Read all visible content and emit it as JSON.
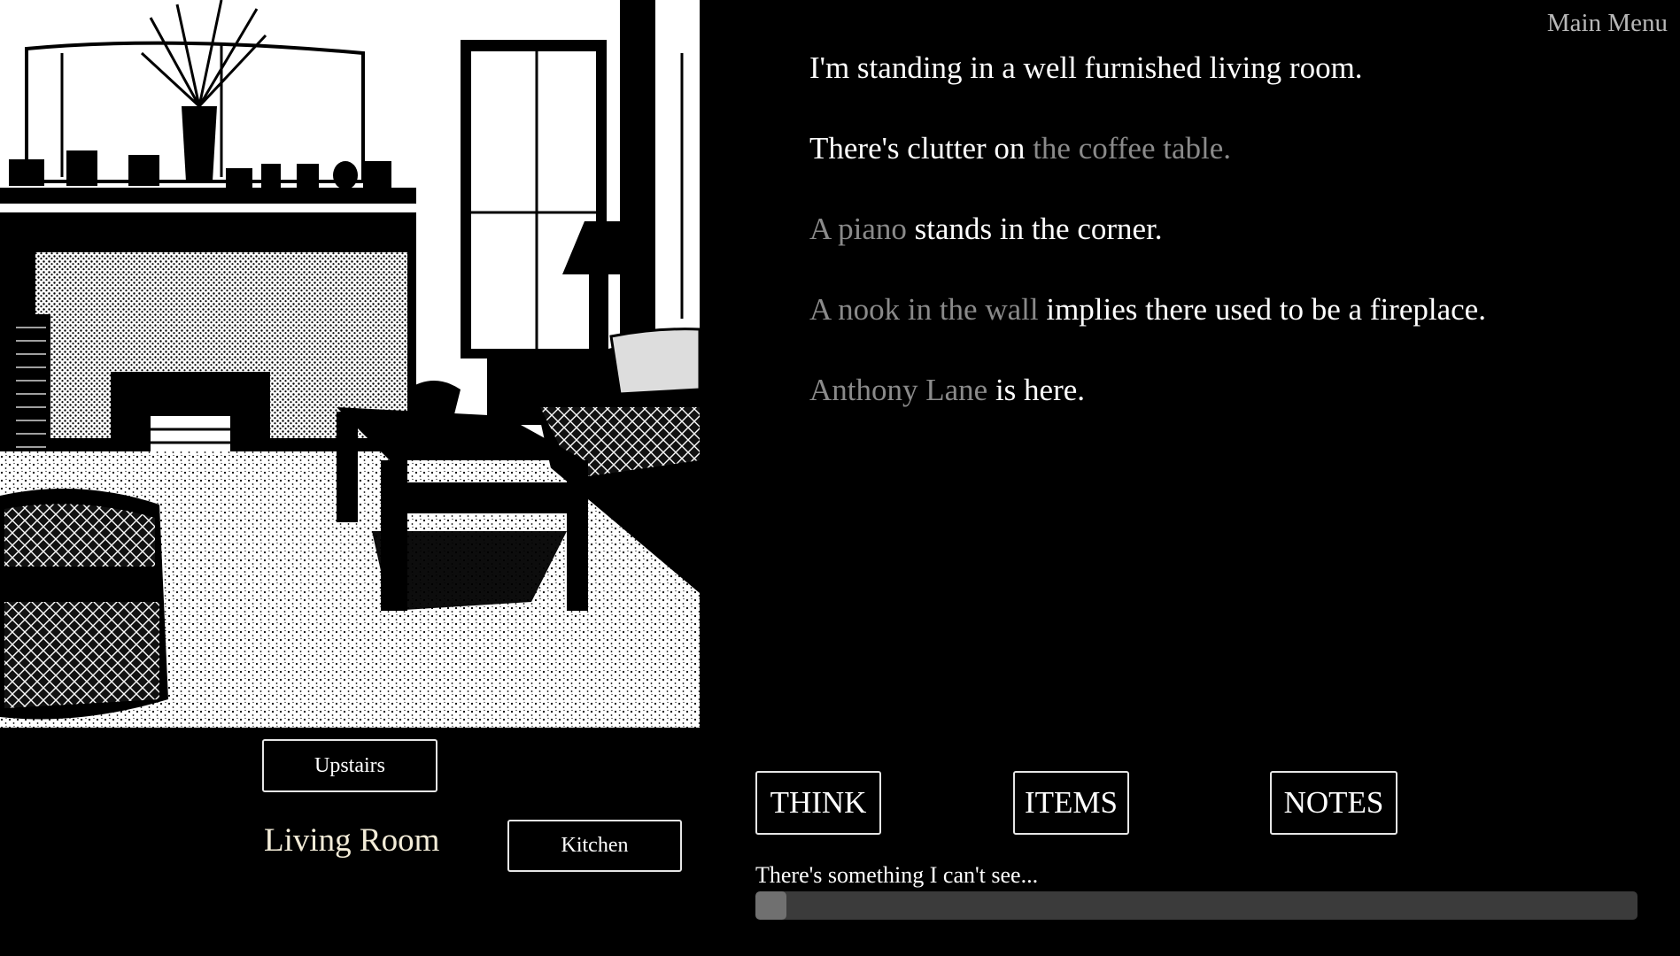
{
  "header": {
    "main_menu_label": "Main Menu"
  },
  "narrative": [
    {
      "text_before": "I'm standing in a well furnished living room.",
      "link": "",
      "text_after": ""
    },
    {
      "text_before": "There's clutter on ",
      "link": "the coffee table.",
      "text_after": ""
    },
    {
      "text_before": "",
      "link": "A piano",
      "text_after": " stands in the corner."
    },
    {
      "text_before": "",
      "link": "A nook in the wall",
      "text_after": " implies there used to be a fireplace."
    },
    {
      "text_before": "",
      "link": "Anthony Lane",
      "text_after": " is here."
    }
  ],
  "navigation": {
    "up_label": "Upstairs",
    "current_location": "Living Room",
    "right_label": "Kitchen"
  },
  "actions": {
    "think_label": "THINK",
    "items_label": "ITEMS",
    "notes_label": "NOTES"
  },
  "status": {
    "message": "There's something I can't see...",
    "progress": 0.035
  },
  "colors": {
    "background": "#000000",
    "text": "#ffffff",
    "link": "#8a8a8a",
    "location": "#f3ecd8",
    "progress_track": "#3b3b3b",
    "progress_fill": "#707070"
  }
}
